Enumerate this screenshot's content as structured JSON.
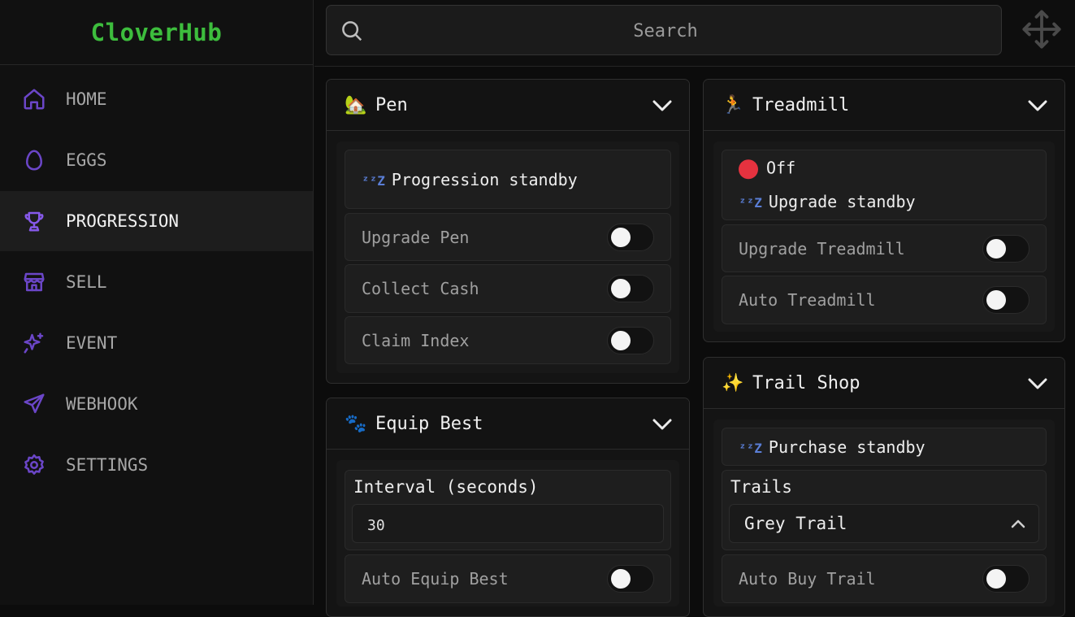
{
  "brand": "CloverHub",
  "search": {
    "placeholder": "Search"
  },
  "sidebar": {
    "items": [
      {
        "label": "HOME",
        "icon": "home-icon"
      },
      {
        "label": "EGGS",
        "icon": "egg-icon"
      },
      {
        "label": "PROGRESSION",
        "icon": "trophy-icon",
        "active": true
      },
      {
        "label": "SELL",
        "icon": "store-icon"
      },
      {
        "label": "EVENT",
        "icon": "sparkles-icon"
      },
      {
        "label": "WEBHOOK",
        "icon": "send-icon"
      },
      {
        "label": "SETTINGS",
        "icon": "gear-icon"
      }
    ]
  },
  "panels": {
    "pen": {
      "emoji": "🏡",
      "title": "Pen",
      "status": "Progression standby",
      "toggles": [
        "Upgrade Pen",
        "Collect Cash",
        "Claim Index"
      ]
    },
    "equip": {
      "emoji": "🐾",
      "title": "Equip Best",
      "interval_label": "Interval (seconds)",
      "interval_value": "30",
      "toggle": "Auto Equip Best"
    },
    "treadmill": {
      "emoji": "🏃",
      "title": "Treadmill",
      "state": "Off",
      "state_color": "#e5323f",
      "status": "Upgrade standby",
      "toggles": [
        "Upgrade Treadmill",
        "Auto Treadmill"
      ]
    },
    "trail": {
      "emoji": "✨",
      "title": "Trail Shop",
      "status": "Purchase standby",
      "select_label": "Trails",
      "select_value": "Grey Trail",
      "toggle": "Auto Buy Trail"
    }
  },
  "zz_glyph": "ᶻᶻZ",
  "colors": {
    "brand": "#3dbd3d",
    "accent": "#6b46c8",
    "knob": "#f4f4f4"
  }
}
